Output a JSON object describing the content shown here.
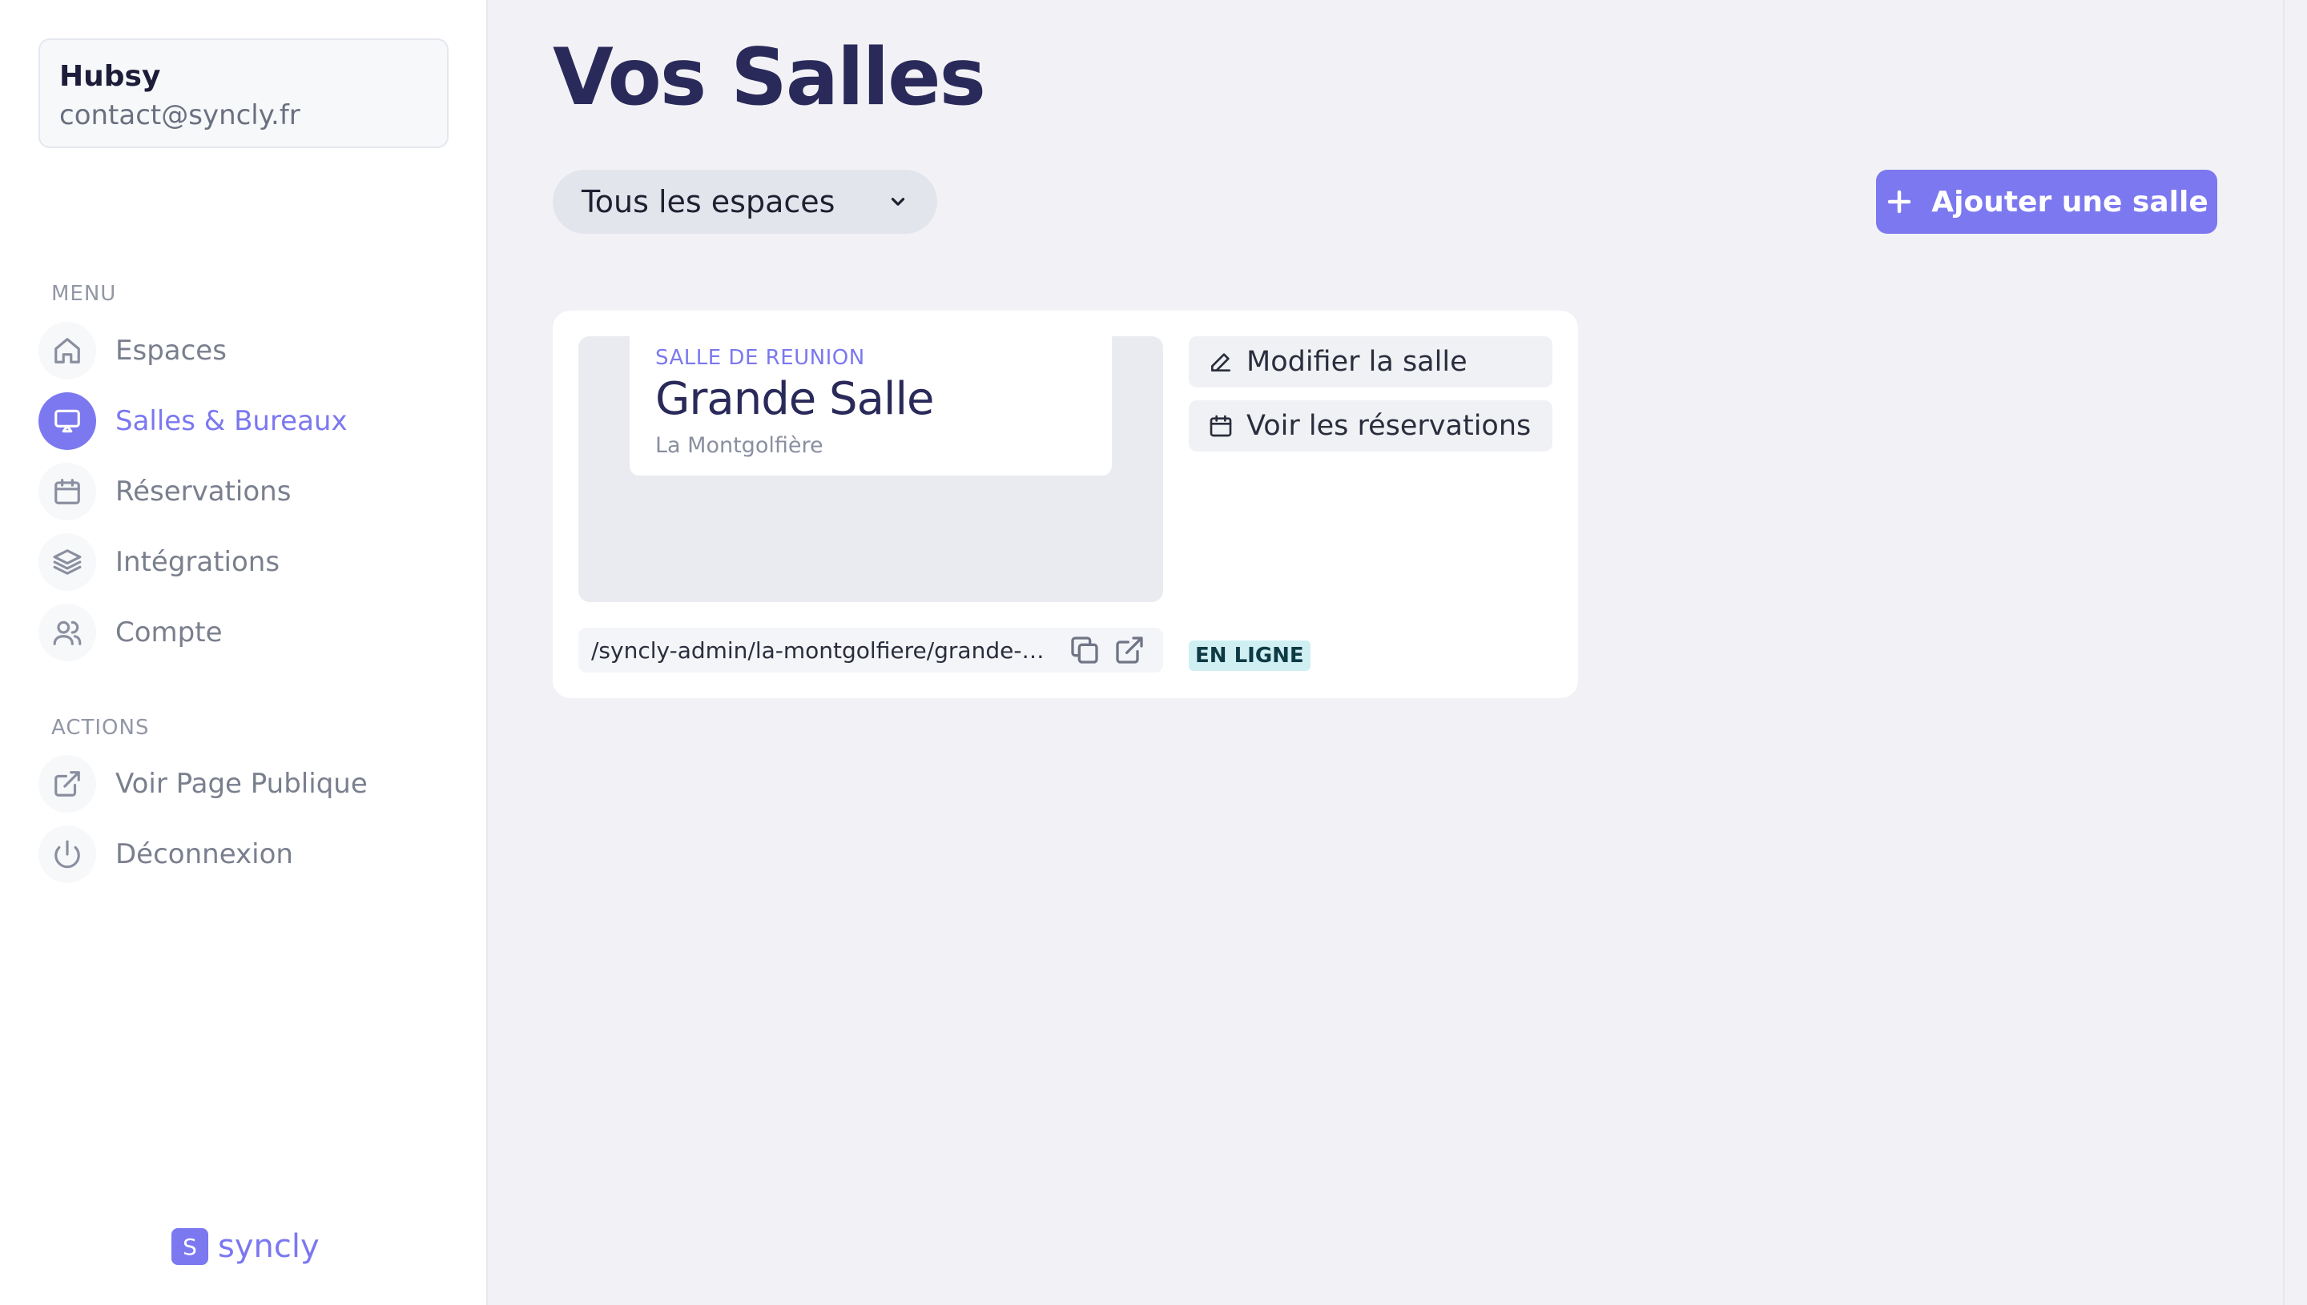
{
  "user": {
    "name": "Hubsy",
    "email": "contact@syncly.fr"
  },
  "sidebar": {
    "menu_title": "MENU",
    "menu_items": [
      {
        "label": "Espaces",
        "icon": "home-icon",
        "active": false
      },
      {
        "label": "Salles & Bureaux",
        "icon": "presentation-icon",
        "active": true
      },
      {
        "label": "Réservations",
        "icon": "calendar-icon",
        "active": false
      },
      {
        "label": "Intégrations",
        "icon": "layers-icon",
        "active": false
      },
      {
        "label": "Compte",
        "icon": "users-icon",
        "active": false
      }
    ],
    "actions_title": "ACTIONS",
    "action_items": [
      {
        "label": "Voir Page Publique",
        "icon": "external-link-icon"
      },
      {
        "label": "Déconnexion",
        "icon": "power-icon"
      }
    ]
  },
  "logo": {
    "badge": "S",
    "text": "syncly"
  },
  "main": {
    "title": "Vos Salles",
    "space_filter": "Tous les espaces",
    "add_button": "Ajouter une salle"
  },
  "rooms": [
    {
      "type": "SALLE DE REUNION",
      "name": "Grande Salle",
      "place": "La Montgolfière",
      "url": "/syncly-admin/la-montgolfiere/grande-salle",
      "edit_label": "Modifier la salle",
      "reservations_label": "Voir les réservations",
      "status": "EN LIGNE"
    }
  ],
  "colors": {
    "accent": "#7b78f0",
    "title": "#2a2a5a",
    "background": "#f2f2f6",
    "status_bg": "#cfeff3"
  }
}
